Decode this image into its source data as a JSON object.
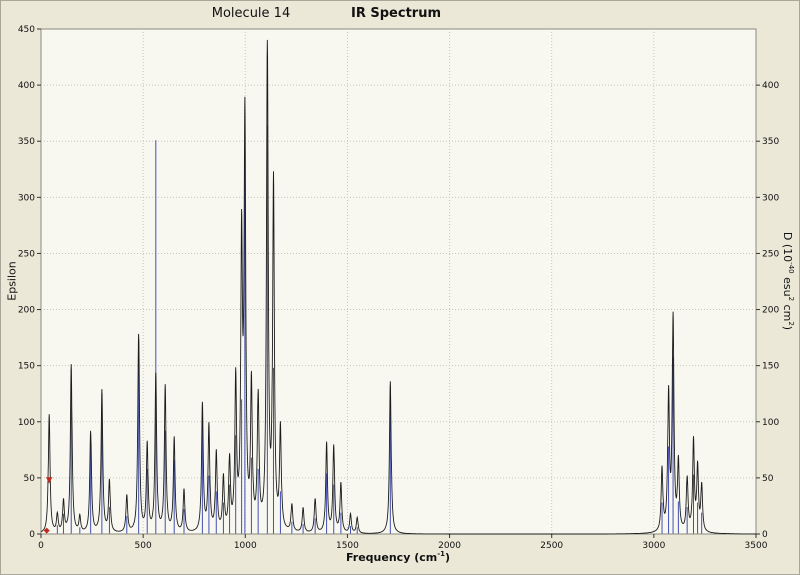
{
  "header": {
    "molecule_label": "Molecule 14",
    "chart_title": "IR Spectrum"
  },
  "axes": {
    "left_label": "Epsilon",
    "x_label_pre": "Frequency (cm",
    "x_label_sup": "-1",
    "x_label_post": ")",
    "right_label_parts": {
      "p1": "D (10",
      "s1": "-40",
      "p2": " esu",
      "s2": "2",
      "p3": " cm",
      "s3": "2",
      "p4": ")"
    }
  },
  "chart_data": {
    "type": "line",
    "title": "IR Spectrum",
    "subtitle": "Molecule 14",
    "xlabel": "Frequency (cm^-1)",
    "ylabel_left": "Epsilon",
    "ylabel_right": "D (10^-40 esu^2 cm^2)",
    "xlim": [
      0,
      3500
    ],
    "ylim_left": [
      0,
      450
    ],
    "ylim_right": [
      0,
      450
    ],
    "x_ticks": [
      0,
      500,
      1000,
      1500,
      2000,
      2500,
      3000,
      3500
    ],
    "y_ticks_left": [
      0,
      50,
      100,
      150,
      200,
      250,
      300,
      350,
      400,
      450
    ],
    "y_ticks_right": [
      0,
      50,
      100,
      150,
      200,
      250,
      300,
      350,
      400
    ],
    "grid": true,
    "legend": null,
    "peak_width_hwhm_cm": 5,
    "peaks_format": [
      "frequency_cm-1",
      "epsilon_curve_height",
      "D_stick_height"
    ],
    "peaks": [
      [
        40,
        106,
        0
      ],
      [
        80,
        16,
        8
      ],
      [
        110,
        28,
        18
      ],
      [
        148,
        150,
        136
      ],
      [
        190,
        14,
        6
      ],
      [
        243,
        90,
        78
      ],
      [
        298,
        127,
        112
      ],
      [
        335,
        46,
        24
      ],
      [
        420,
        33,
        16
      ],
      [
        478,
        176,
        156
      ],
      [
        520,
        78,
        58
      ],
      [
        562,
        140,
        351
      ],
      [
        608,
        130,
        92
      ],
      [
        652,
        84,
        66
      ],
      [
        700,
        38,
        22
      ],
      [
        790,
        114,
        102
      ],
      [
        822,
        94,
        52
      ],
      [
        858,
        70,
        38
      ],
      [
        893,
        47,
        28
      ],
      [
        923,
        62,
        44
      ],
      [
        953,
        133,
        88
      ],
      [
        982,
        250,
        120
      ],
      [
        998,
        360,
        338
      ],
      [
        1030,
        128,
        68
      ],
      [
        1063,
        116,
        58
      ],
      [
        1108,
        428,
        364
      ],
      [
        1138,
        308,
        148
      ],
      [
        1172,
        90,
        38
      ],
      [
        1228,
        24,
        11
      ],
      [
        1283,
        22,
        9
      ],
      [
        1342,
        30,
        14
      ],
      [
        1398,
        80,
        54
      ],
      [
        1433,
        77,
        44
      ],
      [
        1468,
        44,
        19
      ],
      [
        1515,
        17,
        7
      ],
      [
        1548,
        14,
        6
      ],
      [
        1710,
        136,
        117
      ],
      [
        3040,
        56,
        28
      ],
      [
        3072,
        121,
        78
      ],
      [
        3094,
        189,
        158
      ],
      [
        3120,
        61,
        29
      ],
      [
        3163,
        47,
        24
      ],
      [
        3194,
        81,
        53
      ],
      [
        3214,
        57,
        28
      ],
      [
        3234,
        41,
        19
      ]
    ],
    "markers": [
      {
        "x": 40,
        "y": 48,
        "shape": "triangle-down",
        "color": "#c22b20"
      },
      {
        "x": 28,
        "y": 3,
        "shape": "diamond",
        "color": "#c22b20"
      }
    ],
    "colors": {
      "curve": "#1c1c1c",
      "sticks": "#4150b4",
      "marker": "#c22b20",
      "grid": "#c6c6bd",
      "plot_bg": "#f9f8f0",
      "window_bg": "#ebe8d8",
      "axis": "#333333",
      "border": "#8a8a80"
    }
  }
}
